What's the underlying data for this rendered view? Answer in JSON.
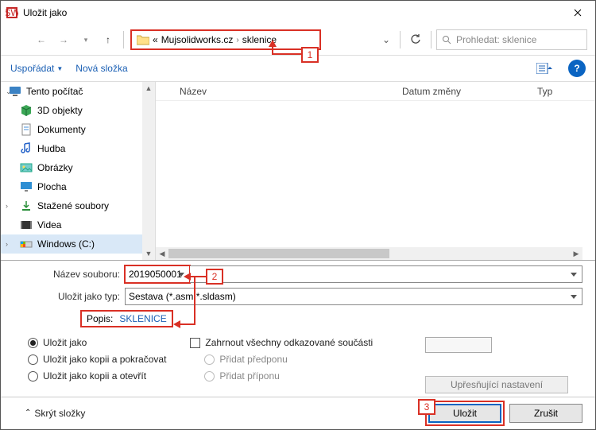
{
  "window": {
    "title": "Uložit jako"
  },
  "nav": {
    "crumbs": [
      "«",
      "Mujsolidworks.cz",
      "sklenice"
    ],
    "search_placeholder": "Prohledat: sklenice"
  },
  "toolbar": {
    "organize": "Uspořádat",
    "newfolder": "Nová složka"
  },
  "tree": {
    "items": [
      {
        "label": "Tento počítač",
        "icon": "monitor"
      },
      {
        "label": "3D objekty",
        "icon": "obj3d"
      },
      {
        "label": "Dokumenty",
        "icon": "doc"
      },
      {
        "label": "Hudba",
        "icon": "music"
      },
      {
        "label": "Obrázky",
        "icon": "image"
      },
      {
        "label": "Plocha",
        "icon": "desktop"
      },
      {
        "label": "Stažené soubory",
        "icon": "download"
      },
      {
        "label": "Videa",
        "icon": "video"
      },
      {
        "label": "Windows (C:)",
        "icon": "drive",
        "selected": true
      }
    ]
  },
  "list": {
    "cols": {
      "name": "Název",
      "date": "Datum změny",
      "type": "Typ"
    }
  },
  "fields": {
    "name_label": "Název souboru:",
    "name_value": "2019050001",
    "type_label": "Uložit jako typ:",
    "type_value": "Sestava (*.asm;*.sldasm)",
    "desc_label": "Popis:",
    "desc_value": "SKLENICE"
  },
  "options": {
    "saveas": "Uložit jako",
    "saveascopycont": "Uložit jako kopii a pokračovat",
    "saveascopyopen": "Uložit jako kopii a otevřít",
    "include": "Zahrnout všechny odkazované součásti",
    "prefix": "Přidat předponu",
    "suffix": "Přidat příponu",
    "advanced": "Upřesňující nastavení"
  },
  "footer": {
    "hide": "Skrýt složky",
    "save": "Uložit",
    "cancel": "Zrušit"
  },
  "callouts": {
    "c1": "1",
    "c2": "2",
    "c3": "3"
  }
}
